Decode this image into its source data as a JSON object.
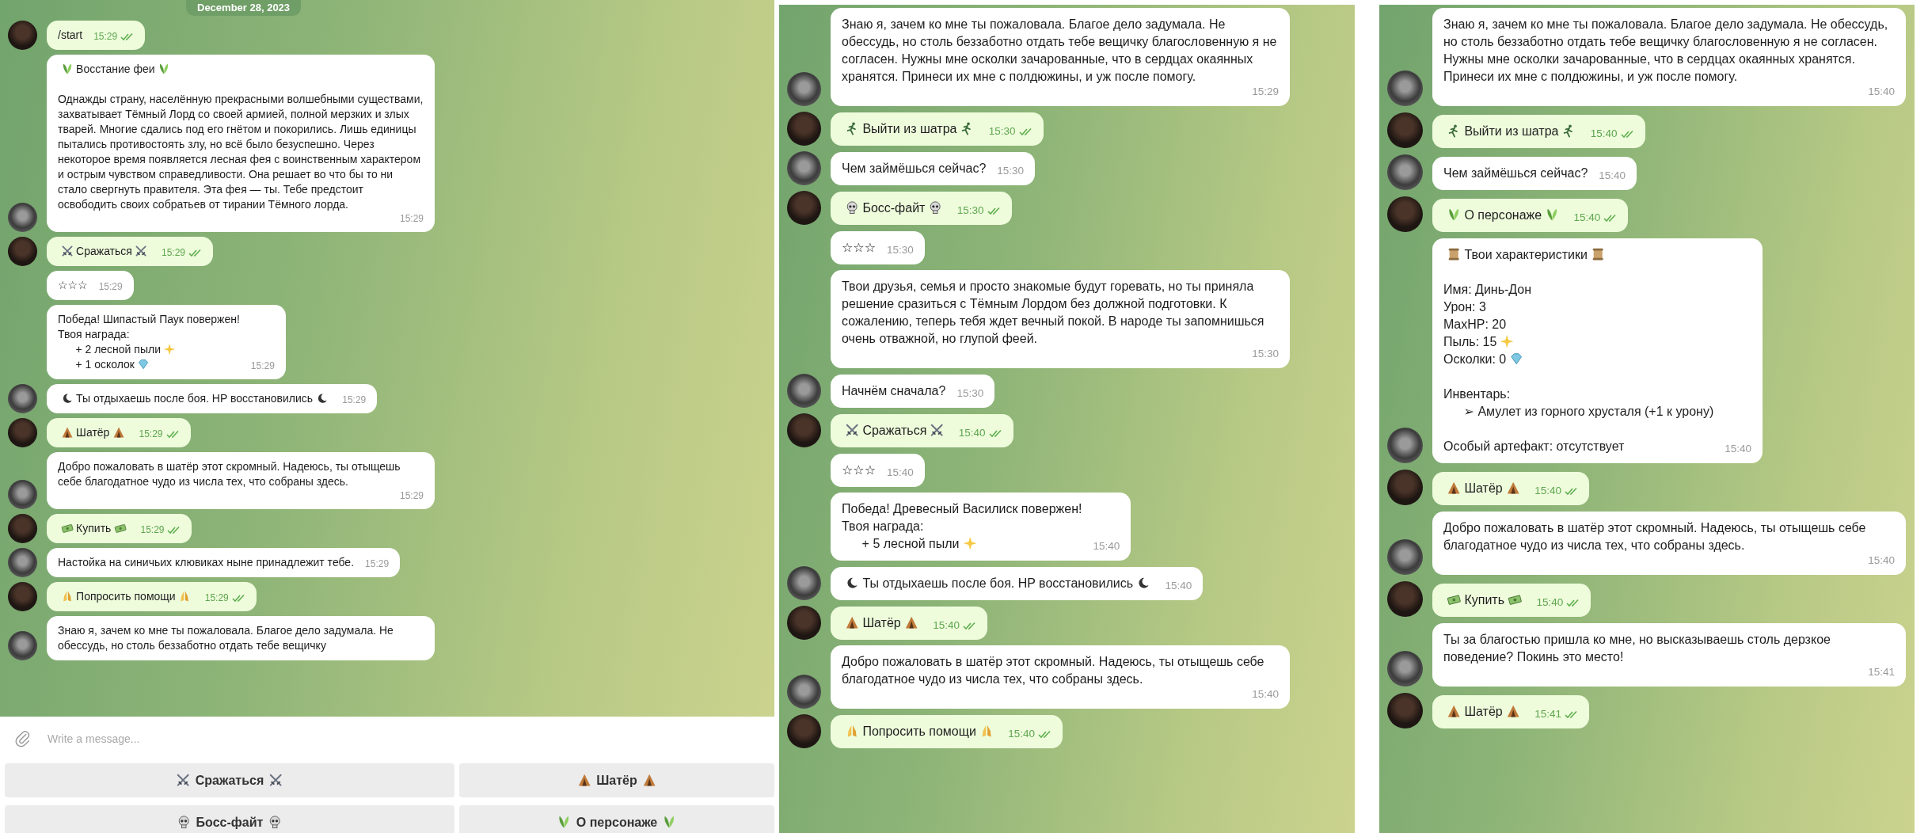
{
  "panels": [
    {
      "date_badge": "December 28, 2023",
      "messages": [
        {
          "kind": "outgoing",
          "avatar": true,
          "lines": [
            {
              "text": "/start"
            }
          ],
          "time": "15:29",
          "read": true
        },
        {
          "kind": "incoming",
          "avatar": true,
          "sections": [
            {
              "lines": [
                {
                  "parts": [
                    {
                      "kind": "leaf"
                    },
                    {
                      "kind": "text",
                      "text": "Восстание феи"
                    },
                    {
                      "kind": "leaf"
                    }
                  ]
                }
              ]
            },
            {
              "lines": [
                {
                  "text": "Однажды страну, населённую прекрасными волшебными существами, захватывает Тёмный Лорд со своей армией, полной мерзких и злых тварей. Многие сдались под его гнётом и покорились. Лишь единицы пытались противостоять злу, но всё было безуспешно. Через некоторое время появляется лесная фея с воинственным характером и острым чувством справедливости. Она решает во что бы то ни стало свергнуть правителя. Эта фея — ты. Тебе предстоит освободить своих собратьев от тирании Тёмного лорда."
                }
              ]
            }
          ],
          "time": "15:29"
        },
        {
          "kind": "outgoing",
          "avatar": true,
          "lines": [
            {
              "parts": [
                {
                  "kind": "swords"
                },
                {
                  "kind": "text",
                  "text": "Сражаться"
                },
                {
                  "kind": "swords"
                }
              ]
            }
          ],
          "time": "15:29",
          "read": true
        },
        {
          "kind": "incoming",
          "avatar": false,
          "lines": [
            {
              "text": "☆☆☆"
            }
          ],
          "time": "15:29"
        },
        {
          "kind": "incoming",
          "avatar": false,
          "lines": [
            {
              "text": "Победа! Шипастый Паук повержен!"
            },
            {
              "text": "Твоя награда:"
            },
            {
              "indent": true,
              "parts": [
                {
                  "kind": "text",
                  "text": "+ 2 лесной пыли"
                },
                {
                  "kind": "sparkle"
                }
              ]
            },
            {
              "indent": true,
              "parts": [
                {
                  "kind": "text",
                  "text": "+ 1 осколок"
                },
                {
                  "kind": "gem"
                }
              ]
            }
          ],
          "time": "15:29"
        },
        {
          "kind": "incoming",
          "avatar": true,
          "lines": [
            {
              "parts": [
                {
                  "kind": "rest"
                },
                {
                  "kind": "text",
                  "text": "Ты отдыхаешь после боя. HP восстановились"
                },
                {
                  "kind": "rest"
                }
              ]
            }
          ],
          "time": "15:29"
        },
        {
          "kind": "outgoing",
          "avatar": true,
          "lines": [
            {
              "parts": [
                {
                  "kind": "tent"
                },
                {
                  "kind": "text",
                  "text": "Шатёр"
                },
                {
                  "kind": "tent"
                }
              ]
            }
          ],
          "time": "15:29",
          "read": true
        },
        {
          "kind": "incoming",
          "avatar": true,
          "lines": [
            {
              "text": "Добро пожаловать в шатёр этот скромный. Надеюсь, ты отыщешь себе благодатное чудо из числа тех, что собраны здесь."
            }
          ],
          "time": "15:29"
        },
        {
          "kind": "outgoing",
          "avatar": true,
          "lines": [
            {
              "parts": [
                {
                  "kind": "money"
                },
                {
                  "kind": "text",
                  "text": "Купить"
                },
                {
                  "kind": "money"
                }
              ]
            }
          ],
          "time": "15:29",
          "read": true
        },
        {
          "kind": "incoming",
          "avatar": true,
          "lines": [
            {
              "text": "Настойка на синичьих клювиках ныне принадлежит тебе."
            }
          ],
          "time": "15:29"
        },
        {
          "kind": "outgoing",
          "avatar": true,
          "lines": [
            {
              "parts": [
                {
                  "kind": "pray"
                },
                {
                  "kind": "text",
                  "text": "Попросить помощи"
                },
                {
                  "kind": "pray"
                }
              ]
            }
          ],
          "time": "15:29",
          "read": true
        },
        {
          "kind": "incoming",
          "avatar": true,
          "lines": [
            {
              "text": "Знаю я, зачем ко мне ты пожаловала. Благое дело задумала. Не обессудь, но столь беззаботно отдать тебе вещичку"
            }
          ]
        }
      ],
      "composer": {
        "placeholder": "Write a message..."
      },
      "keyboard": [
        {
          "parts": [
            {
              "kind": "swords"
            },
            {
              "kind": "text",
              "text": "Сражаться"
            },
            {
              "kind": "swords"
            }
          ]
        },
        {
          "parts": [
            {
              "kind": "tent"
            },
            {
              "kind": "text",
              "text": "Шатёр"
            },
            {
              "kind": "tent"
            }
          ]
        },
        {
          "parts": [
            {
              "kind": "skull"
            },
            {
              "kind": "text",
              "text": "Босс-файт"
            },
            {
              "kind": "skull"
            }
          ]
        },
        {
          "parts": [
            {
              "kind": "leaf"
            },
            {
              "kind": "text",
              "text": "О персонаже"
            },
            {
              "kind": "leaf"
            }
          ]
        }
      ]
    },
    {
      "messages": [
        {
          "kind": "incoming",
          "avatar": true,
          "lines": [
            {
              "text": "Знаю я, зачем ко мне ты пожаловала. Благое дело задумала. Не обессудь, но столь беззаботно отдать тебе вещичку благословенную я не согласен. Нужны мне осколки зачарованные, что в сердцах окаянных хранятся. Принеси их мне с полдюжины, и уж после помогу."
            }
          ],
          "time": "15:29"
        },
        {
          "kind": "outgoing",
          "avatar": true,
          "lines": [
            {
              "parts": [
                {
                  "kind": "runner"
                },
                {
                  "kind": "text",
                  "text": "Выйти из шатра"
                },
                {
                  "kind": "runner"
                }
              ]
            }
          ],
          "time": "15:30",
          "read": true
        },
        {
          "kind": "incoming",
          "avatar": true,
          "lines": [
            {
              "text": "Чем займёшься сейчас?"
            }
          ],
          "time": "15:30"
        },
        {
          "kind": "outgoing",
          "avatar": true,
          "lines": [
            {
              "parts": [
                {
                  "kind": "skull"
                },
                {
                  "kind": "text",
                  "text": "Босс-файт"
                },
                {
                  "kind": "skull"
                }
              ]
            }
          ],
          "time": "15:30",
          "read": true
        },
        {
          "kind": "incoming",
          "avatar": false,
          "lines": [
            {
              "text": "☆☆☆"
            }
          ],
          "time": "15:30"
        },
        {
          "kind": "incoming",
          "avatar": false,
          "lines": [
            {
              "text": "Твои друзья, семья и просто знакомые будут горевать, но ты приняла решение сразиться с Тёмным Лордом без должной подготовки. К сожалению, теперь тебя ждет вечный покой. В народе ты запомнишься очень отважной, но глупой феей."
            }
          ],
          "time": "15:30"
        },
        {
          "kind": "incoming",
          "avatar": true,
          "lines": [
            {
              "text": "Начнём сначала?"
            }
          ],
          "time": "15:30"
        },
        {
          "kind": "outgoing",
          "avatar": true,
          "lines": [
            {
              "parts": [
                {
                  "kind": "swords"
                },
                {
                  "kind": "text",
                  "text": "Сражаться"
                },
                {
                  "kind": "swords"
                }
              ]
            }
          ],
          "time": "15:40",
          "read": true
        },
        {
          "kind": "incoming",
          "avatar": false,
          "lines": [
            {
              "text": "☆☆☆"
            }
          ],
          "time": "15:40"
        },
        {
          "kind": "incoming",
          "avatar": false,
          "lines": [
            {
              "text": "Победа! Древесный Василиск повержен!"
            },
            {
              "text": "Твоя награда:"
            },
            {
              "indent": true,
              "parts": [
                {
                  "kind": "text",
                  "text": "+ 5 лесной пыли"
                },
                {
                  "kind": "sparkle"
                }
              ]
            }
          ],
          "time": "15:40"
        },
        {
          "kind": "incoming",
          "avatar": true,
          "lines": [
            {
              "parts": [
                {
                  "kind": "rest"
                },
                {
                  "kind": "text",
                  "text": "Ты отдыхаешь после боя. HP восстановились"
                },
                {
                  "kind": "rest"
                }
              ]
            }
          ],
          "time": "15:40"
        },
        {
          "kind": "outgoing",
          "avatar": true,
          "lines": [
            {
              "parts": [
                {
                  "kind": "tent"
                },
                {
                  "kind": "text",
                  "text": "Шатёр"
                },
                {
                  "kind": "tent"
                }
              ]
            }
          ],
          "time": "15:40",
          "read": true
        },
        {
          "kind": "incoming",
          "avatar": true,
          "lines": [
            {
              "text": "Добро пожаловать в шатёр этот скромный. Надеюсь, ты отыщешь себе благодатное чудо из числа тех, что собраны здесь."
            }
          ],
          "time": "15:40"
        },
        {
          "kind": "outgoing",
          "avatar": true,
          "lines": [
            {
              "parts": [
                {
                  "kind": "pray"
                },
                {
                  "kind": "text",
                  "text": "Попросить помощи"
                },
                {
                  "kind": "pray"
                }
              ]
            }
          ],
          "time": "15:40",
          "read": true
        }
      ]
    },
    {
      "messages": [
        {
          "kind": "incoming",
          "avatar": true,
          "lines": [
            {
              "text": "Знаю я, зачем ко мне ты пожаловала. Благое дело задумала. Не обессудь, но столь беззаботно отдать тебе вещичку благословенную я не согласен. Нужны мне осколки зачарованные, что в сердцах окаянных хранятся. Принеси их мне с полдюжины, и уж после помогу."
            }
          ],
          "time": "15:40"
        },
        {
          "kind": "outgoing",
          "avatar": true,
          "lines": [
            {
              "parts": [
                {
                  "kind": "runner"
                },
                {
                  "kind": "text",
                  "text": "Выйти из шатра"
                },
                {
                  "kind": "runner"
                }
              ]
            }
          ],
          "time": "15:40",
          "read": true
        },
        {
          "kind": "incoming",
          "avatar": true,
          "lines": [
            {
              "text": "Чем займёшься сейчас?"
            }
          ],
          "time": "15:40"
        },
        {
          "kind": "outgoing",
          "avatar": true,
          "lines": [
            {
              "parts": [
                {
                  "kind": "leaf"
                },
                {
                  "kind": "text",
                  "text": "О персонаже"
                },
                {
                  "kind": "leaf"
                }
              ]
            }
          ],
          "time": "15:40",
          "read": true
        },
        {
          "kind": "incoming",
          "avatar": true,
          "sections": [
            {
              "lines": [
                {
                  "parts": [
                    {
                      "kind": "scroll"
                    },
                    {
                      "kind": "text",
                      "text": "Твои характеристики"
                    },
                    {
                      "kind": "scroll"
                    }
                  ]
                }
              ]
            },
            {
              "lines": [
                {
                  "text": "Имя: Динь-Дон"
                },
                {
                  "text": "Урон: 3"
                },
                {
                  "text": "MaxHP: 20"
                },
                {
                  "parts": [
                    {
                      "kind": "text",
                      "text": "Пыль: 15"
                    },
                    {
                      "kind": "sparkle"
                    }
                  ]
                },
                {
                  "parts": [
                    {
                      "kind": "text",
                      "text": "Осколки: 0"
                    },
                    {
                      "kind": "gem"
                    }
                  ]
                }
              ]
            },
            {
              "lines": [
                {
                  "text": "Инвентарь:"
                },
                {
                  "indent": true,
                  "text": "➢ Амулет из горного хрусталя (+1 к урону)"
                }
              ]
            },
            {
              "lines": [
                {
                  "text": "Особый артефакт: отсутствует"
                }
              ]
            }
          ],
          "time": "15:40"
        },
        {
          "kind": "outgoing",
          "avatar": true,
          "lines": [
            {
              "parts": [
                {
                  "kind": "tent"
                },
                {
                  "kind": "text",
                  "text": "Шатёр"
                },
                {
                  "kind": "tent"
                }
              ]
            }
          ],
          "time": "15:40",
          "read": true
        },
        {
          "kind": "incoming",
          "avatar": true,
          "lines": [
            {
              "text": "Добро пожаловать в шатёр этот скромный. Надеюсь, ты отыщешь себе благодатное чудо из числа тех, что собраны здесь."
            }
          ],
          "time": "15:40"
        },
        {
          "kind": "outgoing",
          "avatar": true,
          "lines": [
            {
              "parts": [
                {
                  "kind": "money"
                },
                {
                  "kind": "text",
                  "text": "Купить"
                },
                {
                  "kind": "money"
                }
              ]
            }
          ],
          "time": "15:40",
          "read": true
        },
        {
          "kind": "incoming",
          "avatar": true,
          "lines": [
            {
              "text": "Ты за благостью пришла ко мне, но высказываешь столь дерзкое поведение? Покинь это место!"
            }
          ],
          "time": "15:41"
        },
        {
          "kind": "outgoing",
          "avatar": true,
          "lines": [
            {
              "parts": [
                {
                  "kind": "tent"
                },
                {
                  "kind": "text",
                  "text": "Шатёр"
                },
                {
                  "kind": "tent"
                }
              ]
            }
          ],
          "time": "15:41",
          "read": true
        }
      ]
    }
  ]
}
